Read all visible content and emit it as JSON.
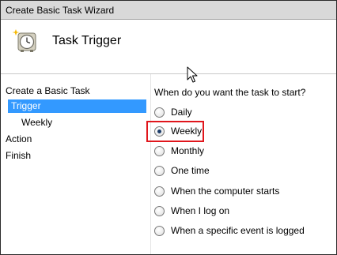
{
  "window": {
    "title": "Create Basic Task Wizard"
  },
  "header": {
    "title": "Task Trigger",
    "icon": "clock-task-icon"
  },
  "sidebar": {
    "items": [
      {
        "label": "Create a Basic Task",
        "active": false,
        "sub": false
      },
      {
        "label": "Trigger",
        "active": true,
        "sub": false
      },
      {
        "label": "Weekly",
        "active": false,
        "sub": true
      },
      {
        "label": "Action",
        "active": false,
        "sub": false
      },
      {
        "label": "Finish",
        "active": false,
        "sub": false
      }
    ]
  },
  "content": {
    "question": "When do you want the task to start?",
    "options": [
      {
        "label": "Daily",
        "checked": false
      },
      {
        "label": "Weekly",
        "checked": true
      },
      {
        "label": "Monthly",
        "checked": false
      },
      {
        "label": "One time",
        "checked": false
      },
      {
        "label": "When the computer starts",
        "checked": false
      },
      {
        "label": "When I log on",
        "checked": false
      },
      {
        "label": "When a specific event is logged",
        "checked": false
      }
    ],
    "selected_option": "Weekly"
  },
  "colors": {
    "selection": "#3399ff",
    "highlight_box": "#e0161c",
    "titlebar": "#d9d9d9"
  }
}
